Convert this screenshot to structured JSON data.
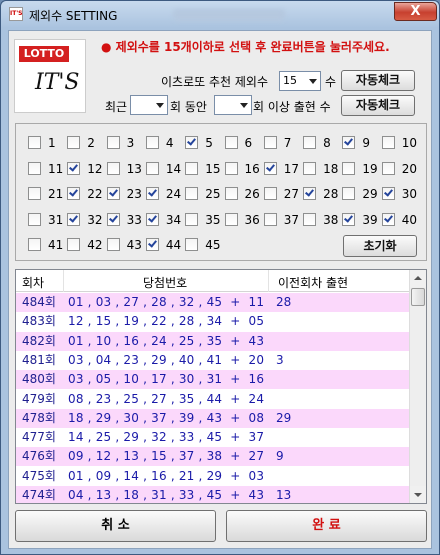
{
  "window": {
    "title": "제외수 SETTING",
    "close_label": "X",
    "app_icon_text": "IT'S"
  },
  "logo": {
    "tag": "LOTTO",
    "main": "IT'S"
  },
  "notice": "● 제외수를 15개이하로 선택 후 완료버튼을 눌러주세요.",
  "recommend": {
    "label": "이츠로또 추천 제외수",
    "value": "15",
    "unit": "수",
    "button": "자동체크"
  },
  "history": {
    "prefix": "최근",
    "period_value": "",
    "mid": "회 동안",
    "count_value": "",
    "suffix": "회 이상 출현 수",
    "button": "자동체크"
  },
  "numbers": [
    {
      "n": "1",
      "checked": false
    },
    {
      "n": "2",
      "checked": false
    },
    {
      "n": "3",
      "checked": false
    },
    {
      "n": "4",
      "checked": false
    },
    {
      "n": "5",
      "checked": true
    },
    {
      "n": "6",
      "checked": false
    },
    {
      "n": "7",
      "checked": false
    },
    {
      "n": "8",
      "checked": false
    },
    {
      "n": "9",
      "checked": true
    },
    {
      "n": "10",
      "checked": false
    },
    {
      "n": "11",
      "checked": false
    },
    {
      "n": "12",
      "checked": true
    },
    {
      "n": "13",
      "checked": false
    },
    {
      "n": "14",
      "checked": false
    },
    {
      "n": "15",
      "checked": false
    },
    {
      "n": "16",
      "checked": false
    },
    {
      "n": "17",
      "checked": true
    },
    {
      "n": "18",
      "checked": false
    },
    {
      "n": "19",
      "checked": false
    },
    {
      "n": "20",
      "checked": false
    },
    {
      "n": "21",
      "checked": false
    },
    {
      "n": "22",
      "checked": true
    },
    {
      "n": "23",
      "checked": true
    },
    {
      "n": "24",
      "checked": true
    },
    {
      "n": "25",
      "checked": false
    },
    {
      "n": "26",
      "checked": false
    },
    {
      "n": "27",
      "checked": false
    },
    {
      "n": "28",
      "checked": true
    },
    {
      "n": "29",
      "checked": false
    },
    {
      "n": "30",
      "checked": true
    },
    {
      "n": "31",
      "checked": false
    },
    {
      "n": "32",
      "checked": true
    },
    {
      "n": "33",
      "checked": true
    },
    {
      "n": "34",
      "checked": true
    },
    {
      "n": "35",
      "checked": false
    },
    {
      "n": "36",
      "checked": false
    },
    {
      "n": "37",
      "checked": false
    },
    {
      "n": "38",
      "checked": false
    },
    {
      "n": "39",
      "checked": true
    },
    {
      "n": "40",
      "checked": true
    },
    {
      "n": "41",
      "checked": false
    },
    {
      "n": "42",
      "checked": false
    },
    {
      "n": "43",
      "checked": false
    },
    {
      "n": "44",
      "checked": true
    },
    {
      "n": "45",
      "checked": false
    }
  ],
  "reset_button": "초기화",
  "table": {
    "headers": [
      "회차",
      "당첨번호",
      "이전회차 출현"
    ],
    "rows": [
      {
        "round": "484회",
        "numbers": "01 , 03 , 27 , 28 , 32 , 45  +  11",
        "prev": "28"
      },
      {
        "round": "483회",
        "numbers": "12 , 15 , 19 , 22 , 28 , 34  +  05",
        "prev": ""
      },
      {
        "round": "482회",
        "numbers": "01 , 10 , 16 , 24 , 25 , 35  +  43",
        "prev": ""
      },
      {
        "round": "481회",
        "numbers": "03 , 04 , 23 , 29 , 40 , 41  +  20",
        "prev": "3"
      },
      {
        "round": "480회",
        "numbers": "03 , 05 , 10 , 17 , 30 , 31  +  16",
        "prev": ""
      },
      {
        "round": "479회",
        "numbers": "08 , 23 , 25 , 27 , 35 , 44  +  24",
        "prev": ""
      },
      {
        "round": "478회",
        "numbers": "18 , 29 , 30 , 37 , 39 , 43  +  08",
        "prev": "29"
      },
      {
        "round": "477회",
        "numbers": "14 , 25 , 29 , 32 , 33 , 45  +  37",
        "prev": ""
      },
      {
        "round": "476회",
        "numbers": "09 , 12 , 13 , 15 , 37 , 38  +  27",
        "prev": "9"
      },
      {
        "round": "475회",
        "numbers": "01 , 09 , 14 , 16 , 21 , 29  +  03",
        "prev": ""
      },
      {
        "round": "474회",
        "numbers": "04 , 13 , 18 , 31 , 33 , 45  +  43",
        "prev": "13"
      }
    ]
  },
  "cancel_button": "취 소",
  "done_button": "완 료",
  "colors": {
    "done_text": "#d21010",
    "notice": "#d21010",
    "row_alt": "#fbd8fb",
    "title_bar": "#aac3df"
  }
}
